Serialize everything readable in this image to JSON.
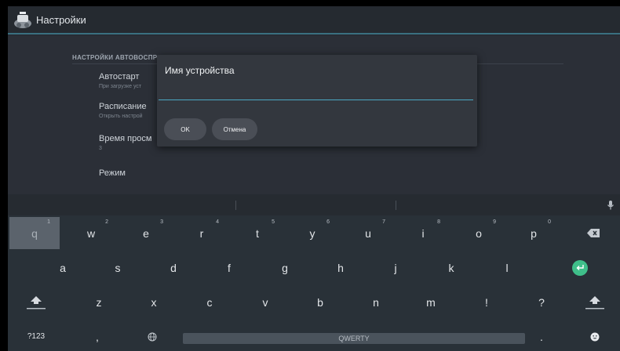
{
  "actionbar": {
    "title": "Настройки",
    "icon": "app-logo-icon"
  },
  "settings": {
    "section_title": "НАСТРОЙКИ АВТОВОСПР",
    "items": [
      {
        "title": "Автостарт",
        "summary": "При загрузке уст"
      },
      {
        "title": "Расписание",
        "summary": "Открыть настрой"
      },
      {
        "title": "Время просм",
        "summary": "3"
      },
      {
        "title": "Режим",
        "summary": ""
      }
    ]
  },
  "dialog": {
    "title": "Имя устройства",
    "input_value": "",
    "ok_label": "OK",
    "cancel_label": "Отмена"
  },
  "keyboard": {
    "row1": [
      {
        "label": "q",
        "hint": "1"
      },
      {
        "label": "w",
        "hint": "2"
      },
      {
        "label": "e",
        "hint": "3"
      },
      {
        "label": "r",
        "hint": "4"
      },
      {
        "label": "t",
        "hint": "5"
      },
      {
        "label": "y",
        "hint": "6"
      },
      {
        "label": "u",
        "hint": "7"
      },
      {
        "label": "i",
        "hint": "8"
      },
      {
        "label": "o",
        "hint": "9"
      },
      {
        "label": "p",
        "hint": "0"
      }
    ],
    "row2": [
      {
        "label": "a"
      },
      {
        "label": "s"
      },
      {
        "label": "d"
      },
      {
        "label": "f"
      },
      {
        "label": "g"
      },
      {
        "label": "h"
      },
      {
        "label": "j"
      },
      {
        "label": "k"
      },
      {
        "label": "l"
      }
    ],
    "row3": [
      {
        "label": "z"
      },
      {
        "label": "x"
      },
      {
        "label": "c"
      },
      {
        "label": "v"
      },
      {
        "label": "b"
      },
      {
        "label": "n"
      },
      {
        "label": "m"
      },
      {
        "label": "!"
      },
      {
        "label": "?"
      }
    ],
    "symbols_label": "?123",
    "comma_label": ",",
    "space_label": "QWERTY",
    "period_label": ".",
    "accent_color": "#3fbf8a"
  }
}
